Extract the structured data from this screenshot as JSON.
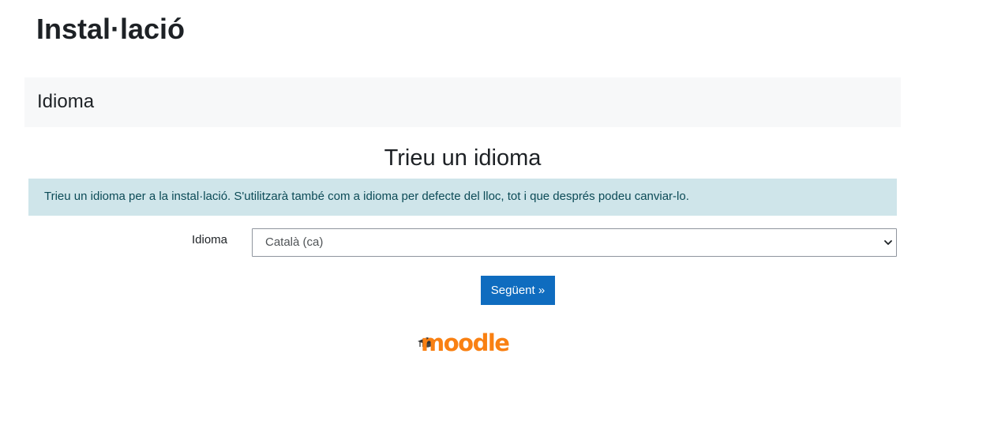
{
  "page": {
    "title": "Instal·lació"
  },
  "section": {
    "title": "Idioma"
  },
  "form": {
    "heading": "Trieu un idioma",
    "info": "Trieu un idioma per a la instal·lació. S'utilitzarà també com a idioma per defecte del lloc, tot i que després podeu canviar-lo.",
    "language_label": "Idioma",
    "language_selected": "Català (ca)",
    "next_label": "Següent »"
  },
  "footer": {
    "logo": "moodle"
  },
  "colors": {
    "primary_button": "#0f6cbf",
    "info_background": "#cfe5ea",
    "info_text": "#0c4b57",
    "section_background": "#f7f8f9",
    "logo_orange": "#f98012"
  },
  "icons": {
    "select_chevron": "chevron-down-icon",
    "logo_cap": "graduation-cap-icon"
  }
}
